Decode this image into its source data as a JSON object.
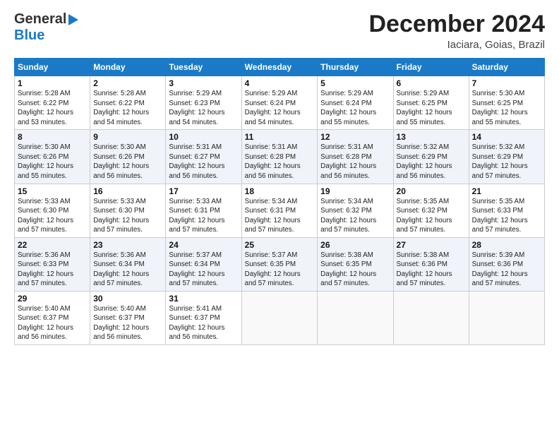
{
  "header": {
    "logo_line1": "General",
    "logo_line2": "Blue",
    "month_title": "December 2024",
    "location": "Iaciara, Goias, Brazil"
  },
  "days_of_week": [
    "Sunday",
    "Monday",
    "Tuesday",
    "Wednesday",
    "Thursday",
    "Friday",
    "Saturday"
  ],
  "weeks": [
    [
      {
        "day": "1",
        "info": "Sunrise: 5:28 AM\nSunset: 6:22 PM\nDaylight: 12 hours\nand 53 minutes."
      },
      {
        "day": "2",
        "info": "Sunrise: 5:28 AM\nSunset: 6:22 PM\nDaylight: 12 hours\nand 54 minutes."
      },
      {
        "day": "3",
        "info": "Sunrise: 5:29 AM\nSunset: 6:23 PM\nDaylight: 12 hours\nand 54 minutes."
      },
      {
        "day": "4",
        "info": "Sunrise: 5:29 AM\nSunset: 6:24 PM\nDaylight: 12 hours\nand 54 minutes."
      },
      {
        "day": "5",
        "info": "Sunrise: 5:29 AM\nSunset: 6:24 PM\nDaylight: 12 hours\nand 55 minutes."
      },
      {
        "day": "6",
        "info": "Sunrise: 5:29 AM\nSunset: 6:25 PM\nDaylight: 12 hours\nand 55 minutes."
      },
      {
        "day": "7",
        "info": "Sunrise: 5:30 AM\nSunset: 6:25 PM\nDaylight: 12 hours\nand 55 minutes."
      }
    ],
    [
      {
        "day": "8",
        "info": "Sunrise: 5:30 AM\nSunset: 6:26 PM\nDaylight: 12 hours\nand 55 minutes."
      },
      {
        "day": "9",
        "info": "Sunrise: 5:30 AM\nSunset: 6:26 PM\nDaylight: 12 hours\nand 56 minutes."
      },
      {
        "day": "10",
        "info": "Sunrise: 5:31 AM\nSunset: 6:27 PM\nDaylight: 12 hours\nand 56 minutes."
      },
      {
        "day": "11",
        "info": "Sunrise: 5:31 AM\nSunset: 6:28 PM\nDaylight: 12 hours\nand 56 minutes."
      },
      {
        "day": "12",
        "info": "Sunrise: 5:31 AM\nSunset: 6:28 PM\nDaylight: 12 hours\nand 56 minutes."
      },
      {
        "day": "13",
        "info": "Sunrise: 5:32 AM\nSunset: 6:29 PM\nDaylight: 12 hours\nand 56 minutes."
      },
      {
        "day": "14",
        "info": "Sunrise: 5:32 AM\nSunset: 6:29 PM\nDaylight: 12 hours\nand 57 minutes."
      }
    ],
    [
      {
        "day": "15",
        "info": "Sunrise: 5:33 AM\nSunset: 6:30 PM\nDaylight: 12 hours\nand 57 minutes."
      },
      {
        "day": "16",
        "info": "Sunrise: 5:33 AM\nSunset: 6:30 PM\nDaylight: 12 hours\nand 57 minutes."
      },
      {
        "day": "17",
        "info": "Sunrise: 5:33 AM\nSunset: 6:31 PM\nDaylight: 12 hours\nand 57 minutes."
      },
      {
        "day": "18",
        "info": "Sunrise: 5:34 AM\nSunset: 6:31 PM\nDaylight: 12 hours\nand 57 minutes."
      },
      {
        "day": "19",
        "info": "Sunrise: 5:34 AM\nSunset: 6:32 PM\nDaylight: 12 hours\nand 57 minutes."
      },
      {
        "day": "20",
        "info": "Sunrise: 5:35 AM\nSunset: 6:32 PM\nDaylight: 12 hours\nand 57 minutes."
      },
      {
        "day": "21",
        "info": "Sunrise: 5:35 AM\nSunset: 6:33 PM\nDaylight: 12 hours\nand 57 minutes."
      }
    ],
    [
      {
        "day": "22",
        "info": "Sunrise: 5:36 AM\nSunset: 6:33 PM\nDaylight: 12 hours\nand 57 minutes."
      },
      {
        "day": "23",
        "info": "Sunrise: 5:36 AM\nSunset: 6:34 PM\nDaylight: 12 hours\nand 57 minutes."
      },
      {
        "day": "24",
        "info": "Sunrise: 5:37 AM\nSunset: 6:34 PM\nDaylight: 12 hours\nand 57 minutes."
      },
      {
        "day": "25",
        "info": "Sunrise: 5:37 AM\nSunset: 6:35 PM\nDaylight: 12 hours\nand 57 minutes."
      },
      {
        "day": "26",
        "info": "Sunrise: 5:38 AM\nSunset: 6:35 PM\nDaylight: 12 hours\nand 57 minutes."
      },
      {
        "day": "27",
        "info": "Sunrise: 5:38 AM\nSunset: 6:36 PM\nDaylight: 12 hours\nand 57 minutes."
      },
      {
        "day": "28",
        "info": "Sunrise: 5:39 AM\nSunset: 6:36 PM\nDaylight: 12 hours\nand 57 minutes."
      }
    ],
    [
      {
        "day": "29",
        "info": "Sunrise: 5:40 AM\nSunset: 6:37 PM\nDaylight: 12 hours\nand 56 minutes."
      },
      {
        "day": "30",
        "info": "Sunrise: 5:40 AM\nSunset: 6:37 PM\nDaylight: 12 hours\nand 56 minutes."
      },
      {
        "day": "31",
        "info": "Sunrise: 5:41 AM\nSunset: 6:37 PM\nDaylight: 12 hours\nand 56 minutes."
      },
      {
        "day": "",
        "info": ""
      },
      {
        "day": "",
        "info": ""
      },
      {
        "day": "",
        "info": ""
      },
      {
        "day": "",
        "info": ""
      }
    ]
  ]
}
